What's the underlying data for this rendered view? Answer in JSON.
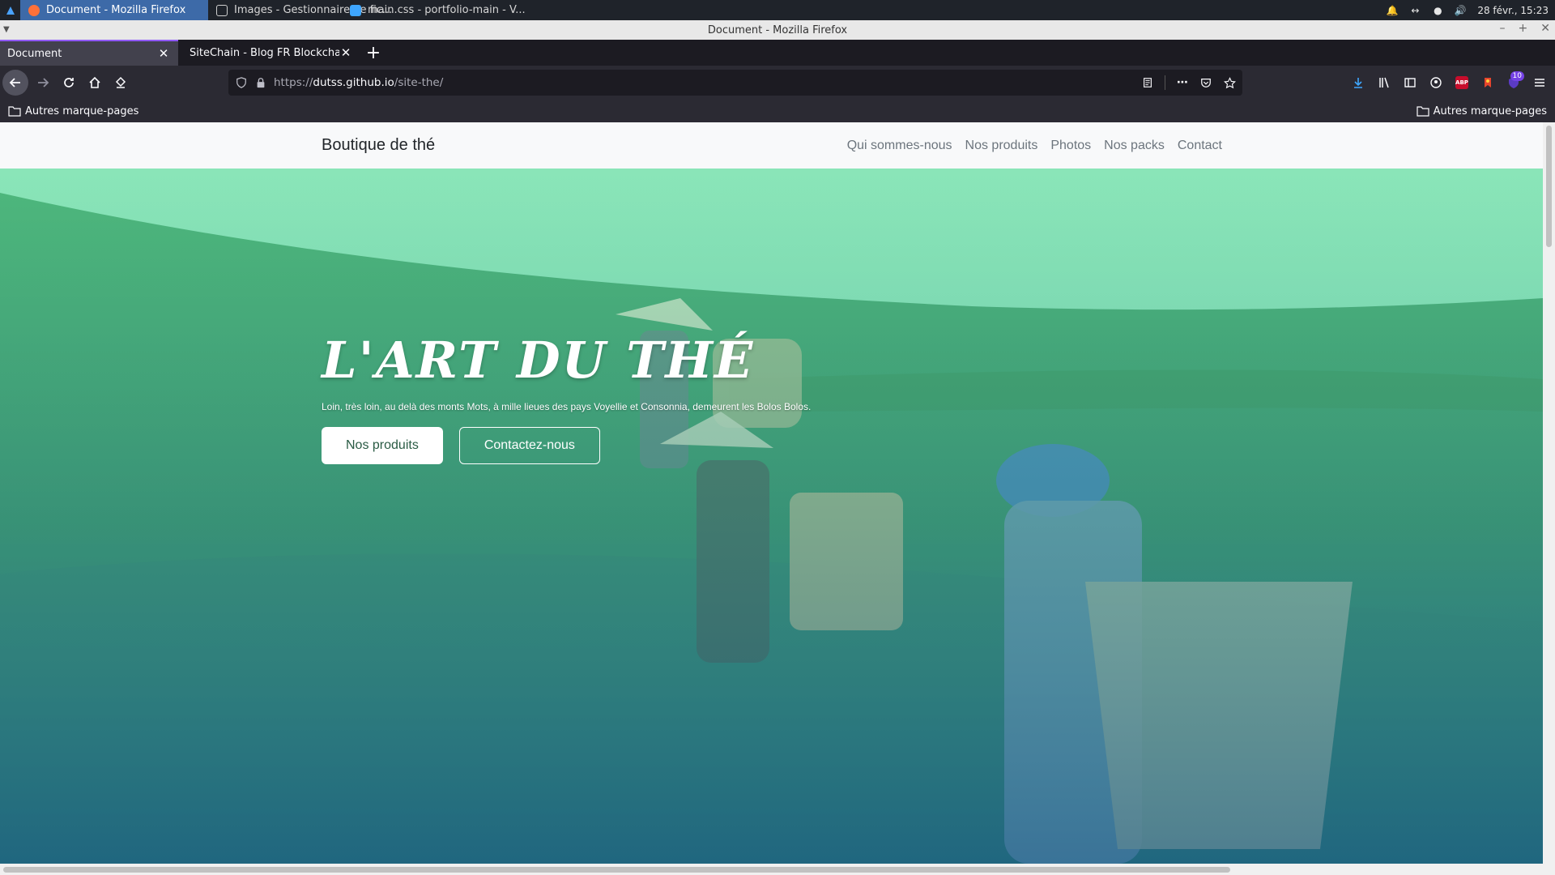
{
  "taskbar": {
    "tasks": [
      {
        "label": "Document - Mozilla Firefox",
        "icon": "firefox-icon",
        "color": "#ff7139"
      },
      {
        "label": "Images - Gestionnaire de fic...",
        "icon": "file-manager-icon",
        "color": "#cfcfcf"
      },
      {
        "label": "main.css - portfolio-main - V...",
        "icon": "vscode-icon",
        "color": "#3ea6ff"
      }
    ],
    "clock": "28 févr., 15:23"
  },
  "window": {
    "title": "Document - Mozilla Firefox"
  },
  "tabs": [
    {
      "label": "Document",
      "active": true
    },
    {
      "label": "SiteChain - Blog FR Blockchain",
      "active": false
    }
  ],
  "urlbar": {
    "prefix": "https://",
    "host": "dutss.github.io",
    "path": "/site-the/"
  },
  "toolbar": {
    "extension_badge": "10",
    "abp_label": "ABP"
  },
  "bookmarks": {
    "left": "Autres marque-pages",
    "right": "Autres marque-pages"
  },
  "site": {
    "brand": "Boutique de thé",
    "nav": [
      "Qui sommes-nous",
      "Nos produits",
      "Photos",
      "Nos packs",
      "Contact"
    ],
    "hero": {
      "title": "L'ART DU THÉ",
      "subtitle": "Loin, très loin, au delà des monts Mots, à mille lieues des pays Voyellie et Consonnia, demeurent les Bolos Bolos.",
      "primary_button": "Nos produits",
      "secondary_button": "Contactez-nous"
    }
  },
  "colors": {
    "hero_overlay_top": "#7be0b0",
    "hero_overlay_bottom": "#1b6a8c",
    "accent_tab": "#9059ff"
  }
}
